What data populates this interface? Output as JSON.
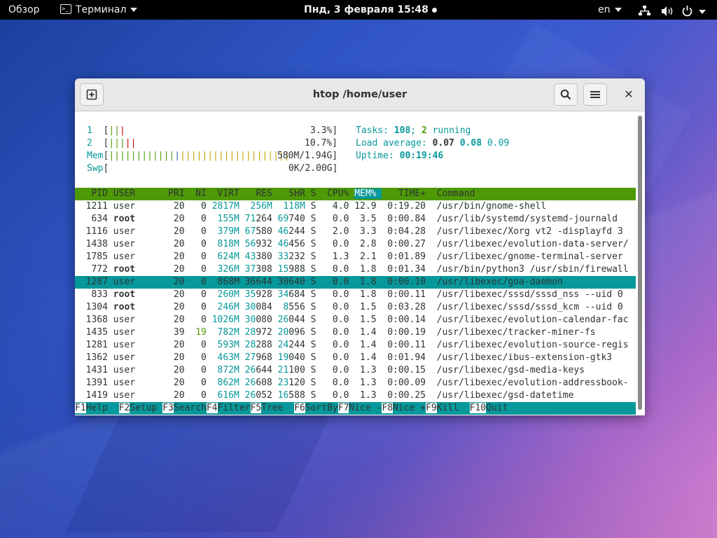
{
  "topbar": {
    "activities": "Обзор",
    "app_menu": "Терминал",
    "clock": "Пнд, 3 февраля  15:48",
    "lang": "en"
  },
  "window": {
    "title": "htop /home/user"
  },
  "htop": {
    "cpu1": {
      "label": "1",
      "bars": "|||",
      "value": "3.3%]"
    },
    "cpu2": {
      "label": "2",
      "bars": "|||||",
      "value": "10.7%]"
    },
    "mem": {
      "label": "Mem",
      "bars": "|||||||||||||||||||||||||||||||||",
      "value": "580M/1.94G]"
    },
    "swp": {
      "label": "Swp",
      "value": "0K/2.00G]"
    },
    "tasks": {
      "label": "Tasks:",
      "total": "108",
      "running": "2",
      "suffix": "running"
    },
    "load": {
      "label": "Load average:",
      "v1": "0.07",
      "v2": "0.08",
      "v3": "0.09"
    },
    "uptime": {
      "label": "Uptime:",
      "value": "00:19:46"
    },
    "columns": [
      "PID",
      "USER",
      "PRI",
      "NI",
      "VIRT",
      "RES",
      "SHR",
      "S",
      "CPU%",
      "MEM%",
      "TIME+",
      "Command"
    ],
    "processes": [
      {
        "pid": "1211",
        "user": "user",
        "pri": "20",
        "ni": "0",
        "virt": "2817M",
        "res": "256M",
        "shr": "118M",
        "s": "S",
        "cpu": "4.0",
        "mem": "12.9",
        "time": "0:19.20",
        "cmd": "/usr/bin/gnome-shell"
      },
      {
        "pid": "634",
        "user": "root",
        "pri": "20",
        "ni": "0",
        "virt": "155M",
        "res": "71264",
        "shr": "69740",
        "s": "S",
        "cpu": "0.0",
        "mem": "3.5",
        "time": "0:00.84",
        "cmd": "/usr/lib/systemd/systemd-journald"
      },
      {
        "pid": "1116",
        "user": "user",
        "pri": "20",
        "ni": "0",
        "virt": "379M",
        "res": "67580",
        "shr": "46244",
        "s": "S",
        "cpu": "2.0",
        "mem": "3.3",
        "time": "0:04.28",
        "cmd": "/usr/libexec/Xorg vt2 -displayfd 3"
      },
      {
        "pid": "1438",
        "user": "user",
        "pri": "20",
        "ni": "0",
        "virt": "818M",
        "res": "56932",
        "shr": "46456",
        "s": "S",
        "cpu": "0.0",
        "mem": "2.8",
        "time": "0:00.27",
        "cmd": "/usr/libexec/evolution-data-server/"
      },
      {
        "pid": "1785",
        "user": "user",
        "pri": "20",
        "ni": "0",
        "virt": "624M",
        "res": "43380",
        "shr": "33232",
        "s": "S",
        "cpu": "1.3",
        "mem": "2.1",
        "time": "0:01.89",
        "cmd": "/usr/libexec/gnome-terminal-server"
      },
      {
        "pid": "772",
        "user": "root",
        "pri": "20",
        "ni": "0",
        "virt": "326M",
        "res": "37308",
        "shr": "15988",
        "s": "S",
        "cpu": "0.0",
        "mem": "1.8",
        "time": "0:01.34",
        "cmd": "/usr/bin/python3 /usr/sbin/firewall"
      },
      {
        "pid": "1287",
        "user": "user",
        "pri": "20",
        "ni": "0",
        "virt": "868M",
        "res": "36644",
        "shr": "30640",
        "s": "S",
        "cpu": "0.0",
        "mem": "1.8",
        "time": "0:00.10",
        "cmd": "/usr/libexec/goa-daemon",
        "selected": true
      },
      {
        "pid": "833",
        "user": "root",
        "pri": "20",
        "ni": "0",
        "virt": "260M",
        "res": "35928",
        "shr": "34684",
        "s": "S",
        "cpu": "0.0",
        "mem": "1.8",
        "time": "0:00.11",
        "cmd": "/usr/libexec/sssd/sssd_nss --uid 0"
      },
      {
        "pid": "1304",
        "user": "root",
        "pri": "20",
        "ni": "0",
        "virt": "246M",
        "res": "30084",
        "shr": "8556",
        "s": "S",
        "cpu": "0.0",
        "mem": "1.5",
        "time": "0:03.28",
        "cmd": "/usr/libexec/sssd/sssd_kcm --uid 0"
      },
      {
        "pid": "1368",
        "user": "user",
        "pri": "20",
        "ni": "0",
        "virt": "1026M",
        "res": "30080",
        "shr": "26044",
        "s": "S",
        "cpu": "0.0",
        "mem": "1.5",
        "time": "0:00.14",
        "cmd": "/usr/libexec/evolution-calendar-fac"
      },
      {
        "pid": "1435",
        "user": "user",
        "pri": "39",
        "ni": "19",
        "virt": "782M",
        "res": "28972",
        "shr": "20096",
        "s": "S",
        "cpu": "0.0",
        "mem": "1.4",
        "time": "0:00.19",
        "cmd": "/usr/libexec/tracker-miner-fs"
      },
      {
        "pid": "1281",
        "user": "user",
        "pri": "20",
        "ni": "0",
        "virt": "593M",
        "res": "28288",
        "shr": "24244",
        "s": "S",
        "cpu": "0.0",
        "mem": "1.4",
        "time": "0:00.11",
        "cmd": "/usr/libexec/evolution-source-regis"
      },
      {
        "pid": "1362",
        "user": "user",
        "pri": "20",
        "ni": "0",
        "virt": "463M",
        "res": "27968",
        "shr": "19040",
        "s": "S",
        "cpu": "0.0",
        "mem": "1.4",
        "time": "0:01.94",
        "cmd": "/usr/libexec/ibus-extension-gtk3"
      },
      {
        "pid": "1431",
        "user": "user",
        "pri": "20",
        "ni": "0",
        "virt": "872M",
        "res": "26644",
        "shr": "21100",
        "s": "S",
        "cpu": "0.0",
        "mem": "1.3",
        "time": "0:00.15",
        "cmd": "/usr/libexec/gsd-media-keys"
      },
      {
        "pid": "1391",
        "user": "user",
        "pri": "20",
        "ni": "0",
        "virt": "862M",
        "res": "26608",
        "shr": "23120",
        "s": "S",
        "cpu": "0.0",
        "mem": "1.3",
        "time": "0:00.09",
        "cmd": "/usr/libexec/evolution-addressbook-"
      },
      {
        "pid": "1419",
        "user": "user",
        "pri": "20",
        "ni": "0",
        "virt": "616M",
        "res": "26052",
        "shr": "16588",
        "s": "S",
        "cpu": "0.0",
        "mem": "1.3",
        "time": "0:00.25",
        "cmd": "/usr/libexec/gsd-datetime"
      }
    ],
    "fkeys": [
      {
        "key": "F1",
        "label": "Help  "
      },
      {
        "key": "F2",
        "label": "Setup "
      },
      {
        "key": "F3",
        "label": "Search"
      },
      {
        "key": "F4",
        "label": "Filter"
      },
      {
        "key": "F5",
        "label": "Tree  "
      },
      {
        "key": "F6",
        "label": "SortBy"
      },
      {
        "key": "F7",
        "label": "Nice -"
      },
      {
        "key": "F8",
        "label": "Nice +"
      },
      {
        "key": "F9",
        "label": "Kill  "
      },
      {
        "key": "F10",
        "label": "Quit  "
      }
    ]
  }
}
